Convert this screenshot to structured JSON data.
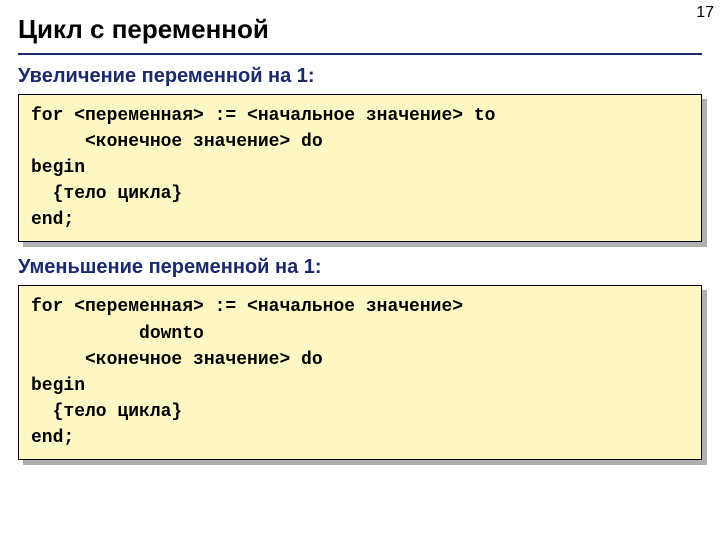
{
  "page_number": "17",
  "title": "Цикл с переменной",
  "section1": {
    "heading": "Увеличение переменной на 1:",
    "code": "for <переменная> := <начальное значение> to\n     <конечное значение> do\nbegin\n  {тело цикла}\nend;"
  },
  "section2": {
    "heading": "Уменьшение переменной на 1:",
    "code": "for <переменная> := <начальное значение>\n          downto\n     <конечное значение> do\nbegin\n  {тело цикла}\nend;"
  }
}
